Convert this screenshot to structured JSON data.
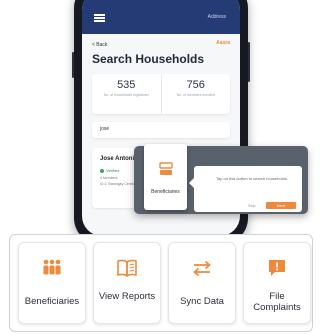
{
  "app": {
    "account_label": "Address",
    "back_label": "< Back",
    "brand_tag": "Aasra",
    "screen_title": "Search Households",
    "stats": [
      {
        "value": "535",
        "caption": "No. of households registered"
      },
      {
        "value": "756",
        "caption": "No. of members enrolled"
      }
    ],
    "search_query": "jose",
    "result": {
      "name": "Jose Antonio",
      "status": "Verified",
      "meta_1": "4 Members",
      "meta_2": "ID 2, Barangay Centro"
    }
  },
  "tooltip": {
    "tile_label": "Beneficiaries",
    "message": "Tap on this button to search households.",
    "skip_label": "Skip",
    "next_label": "Next"
  },
  "tiles": [
    {
      "label": "Beneficiaries",
      "icon": "people-icon"
    },
    {
      "label": "View Reports",
      "icon": "book-icon"
    },
    {
      "label": "Sync Data",
      "icon": "sync-arrows-icon"
    },
    {
      "label": "File Complaints",
      "icon": "alert-bubble-icon"
    }
  ],
  "colors": {
    "accent": "#f08a3a",
    "appbar": "#243b75",
    "phone_body": "#151a22"
  }
}
